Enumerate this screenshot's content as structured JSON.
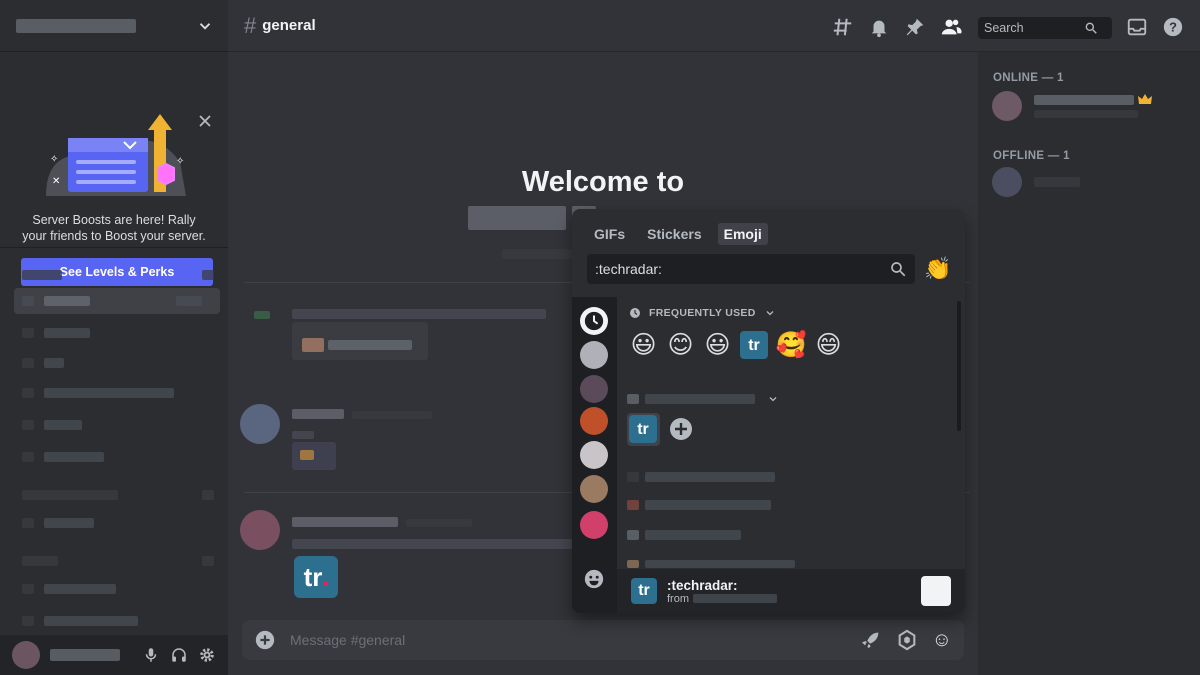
{
  "boost": {
    "text": "Server Boosts are here! Rally your friends to Boost your server.",
    "button_label": "See Levels & Perks"
  },
  "channel": {
    "hash": "#",
    "name": "general",
    "welcome": "Welcome to"
  },
  "search": {
    "placeholder": "Search"
  },
  "composer": {
    "placeholder": "Message #general"
  },
  "members": {
    "online_header": "ONLINE — 1",
    "offline_header": "OFFLINE — 1"
  },
  "picker": {
    "tabs": [
      {
        "label": "GIFs"
      },
      {
        "label": "Stickers"
      },
      {
        "label": "Emoji"
      }
    ],
    "active_tab": "Emoji",
    "search_value": ":techradar:",
    "frequently_used_label": "FREQUENTLY USED",
    "frequent_emoji": [
      "😃",
      "😊",
      "😃",
      "tr",
      "🥰",
      "😄"
    ],
    "server_emoji": [
      "tr"
    ],
    "clap": "👏",
    "preview": {
      "name": ":techradar:",
      "from": "from"
    }
  },
  "attachment": {
    "text": "tr"
  },
  "colors": {
    "blurple": "#5865f2",
    "techradar_blue": "#2d6f8f",
    "techradar_dot": "#e2245a"
  }
}
